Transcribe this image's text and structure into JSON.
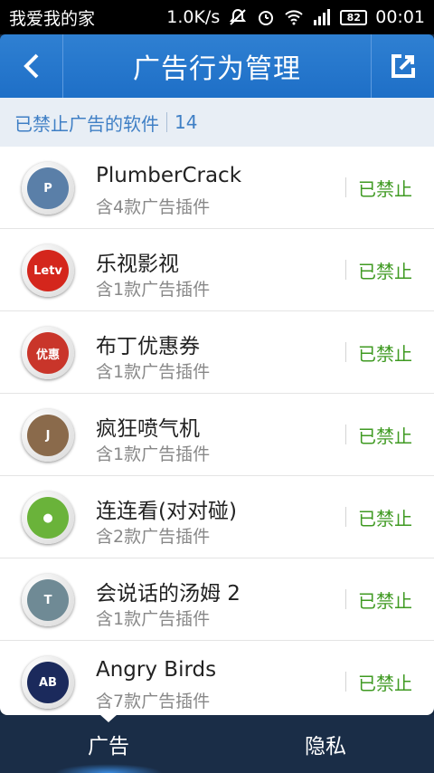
{
  "status_bar": {
    "carrier": "我爱我的家",
    "speed": "1.0K/s",
    "battery": "82",
    "time": "00:01"
  },
  "header": {
    "title": "广告行为管理",
    "back_icon": "back-arrow-icon",
    "share_icon": "export-icon"
  },
  "subheader": {
    "label": "已禁止广告的软件",
    "count": "14"
  },
  "apps": [
    {
      "name": "PlumberCrack",
      "plugins": "含4款广告插件",
      "status": "已禁止",
      "icon": "plumbercrack-app-icon",
      "icon_color": "#5a7fa8",
      "icon_text": "P"
    },
    {
      "name": "乐视影视",
      "plugins": "含1款广告插件",
      "status": "已禁止",
      "icon": "letv-app-icon",
      "icon_color": "#d4261c",
      "icon_text": "Letv"
    },
    {
      "name": "布丁优惠券",
      "plugins": "含1款广告插件",
      "status": "已禁止",
      "icon": "buding-app-icon",
      "icon_color": "#c9352a",
      "icon_text": "优惠"
    },
    {
      "name": "疯狂喷气机",
      "plugins": "含1款广告插件",
      "status": "已禁止",
      "icon": "jetpack-app-icon",
      "icon_color": "#8a6a4b",
      "icon_text": "J"
    },
    {
      "name": "连连看(对对碰)",
      "plugins": "含2款广告插件",
      "status": "已禁止",
      "icon": "fruit-match-app-icon",
      "icon_color": "#6ab33a",
      "icon_text": "●"
    },
    {
      "name": "会说话的汤姆 2",
      "plugins": "含1款广告插件",
      "status": "已禁止",
      "icon": "talking-tom-app-icon",
      "icon_color": "#6f8a95",
      "icon_text": "T"
    },
    {
      "name": "Angry Birds",
      "plugins": "含7款广告插件",
      "status": "已禁止",
      "icon": "angry-birds-app-icon",
      "icon_color": "#1b2a5c",
      "icon_text": "AB"
    }
  ],
  "tabs": [
    {
      "label": "广告",
      "active": true
    },
    {
      "label": "隐私",
      "active": false
    }
  ]
}
